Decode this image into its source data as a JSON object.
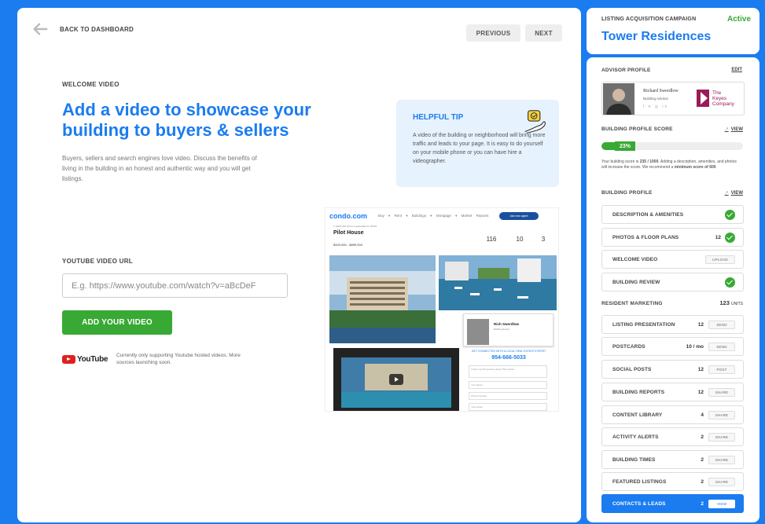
{
  "nav": {
    "back_label": "BACK TO DASHBOARD",
    "previous_label": "PREVIOUS",
    "next_label": "NEXT"
  },
  "main": {
    "section_label": "WELCOME VIDEO",
    "headline": "Add a video to showcase your building to buyers & sellers",
    "description": "Buyers, sellers and search engines love video. Discuss the benefits of living in the building in an honest and authentic way and you will get listings."
  },
  "tip": {
    "title": "HELPFUL TIP",
    "text": "A video of the building or neighborhood will bring more traffic and leads to your page. It is easy to do yourself on your mobile phone or you can have hire a videographer.",
    "icon": "chat-hand-icon"
  },
  "youtube": {
    "label": "YOUTUBE VIDEO URL",
    "placeholder": "E.g. https://www.youtube.com/watch?v=aBcDeF",
    "value": "",
    "button_label": "ADD YOUR VIDEO",
    "logo_text": "YouTube",
    "note": "Currently only supporting Youtube hosted videos. More sources launching soon."
  },
  "preview": {
    "site_logo": "condo.com",
    "menu": "Buy ▾ Rent ▾ Buildings ▾ Mortgage ▾ Market Reports",
    "cta_pill": "Ask new agent",
    "address": "1 VIEW 400 W Fort Lauderdale FL 33301",
    "building_name": "Pilot House",
    "price_range": "$329,900 - $899,000",
    "stats": [
      "116",
      "10",
      "3"
    ],
    "agent_name": "Rich Swerdlow",
    "agent_role": "Building Expert",
    "cta_heading": "GET CONNECTED WITH A LOCAL REAL ESTATE EXPERT",
    "cta_phone": "954-666-5033",
    "cta_fields": [
      "I have a quick question about Pilot House",
      "Your Name",
      "Phone Number",
      "Your Email"
    ]
  },
  "campaign": {
    "label": "LISTING ACQUISITION CAMPAIGN",
    "status": "Active",
    "status_color": "#39a935",
    "title": "Tower Residences"
  },
  "advisor": {
    "heading": "ADVISOR PROFILE",
    "edit_label": "EDIT",
    "name": "Richard Swerdlow",
    "role": "Building Advisor",
    "social": "f ▾ ◎ in",
    "company_line1": "The",
    "company_line2": "Keyes",
    "company_line3": "Company"
  },
  "score": {
    "heading": "BUILDING PROFILE SCORE",
    "view_label": "VIEW",
    "percent_label": "23%",
    "percent_value": 23,
    "text_pre": "Your building score is ",
    "score_value": "235 / 1000",
    "text_mid": ". Adding a description, amenities, and photos will increase the score. We recommend a ",
    "min_score": "minimum score of 600"
  },
  "building_profile": {
    "heading": "BUILDING PROFILE",
    "view_label": "VIEW",
    "items": [
      {
        "label": "DESCRIPTION & AMENITIES",
        "count": "",
        "action": "",
        "done": true
      },
      {
        "label": "PHOTOS & FLOOR PLANS",
        "count": "12",
        "action": "",
        "done": true
      },
      {
        "label": "WELCOME VIDEO",
        "count": "",
        "action": "UPLOAD",
        "done": false
      },
      {
        "label": "BUILDING REVIEW",
        "count": "",
        "action": "",
        "done": true
      }
    ]
  },
  "resident_marketing": {
    "heading": "RESIDENT MARKETING",
    "units_value": "123",
    "units_label": "UNITS",
    "items": [
      {
        "label": "LISTING PRESENTATION",
        "count": "12",
        "action": "SEND"
      },
      {
        "label": "POSTCARDS",
        "count": "10 / mo",
        "action": "SEND"
      },
      {
        "label": "SOCIAL POSTS",
        "count": "12",
        "action": "POST"
      },
      {
        "label": "BUILDING REPORTS",
        "count": "12",
        "action": "SHARE"
      },
      {
        "label": "CONTENT LIBRARY",
        "count": "4",
        "action": "SHARE"
      },
      {
        "label": "ACTIVITY ALERTS",
        "count": "2",
        "action": "SHARE"
      },
      {
        "label": "BUILDING TIMES",
        "count": "2",
        "action": "SHARE"
      },
      {
        "label": "FEATURED LISTINGS",
        "count": "2",
        "action": "SHARE"
      },
      {
        "label": "CONTACTS & LEADS",
        "count": "2",
        "action": "VIEW"
      }
    ]
  },
  "colors": {
    "brand_blue": "#1b7cf0",
    "success_green": "#39a935",
    "keyes_magenta": "#9a1b58"
  }
}
